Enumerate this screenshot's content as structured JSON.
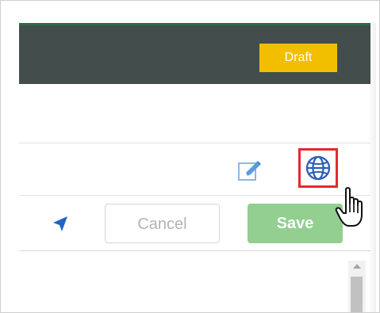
{
  "header": {
    "status_badge": "Draft",
    "colors": {
      "header_bg": "#434d4b",
      "header_top_accent": "#2f6b45",
      "badge_bg": "#f2be00"
    }
  },
  "toolbar": {
    "edit_icon": "edit-icon",
    "globe_icon": "globe-icon",
    "highlight_color": "#e8262e"
  },
  "actions": {
    "navigate_icon": "navigation-arrow-icon",
    "cancel_label": "Cancel",
    "save_label": "Save",
    "save_color": "#92cf90"
  },
  "scrollbar": {
    "up_arrow_icon": "scroll-up-arrow-icon"
  },
  "cursor": {
    "icon": "hand-pointer-cursor-icon"
  }
}
